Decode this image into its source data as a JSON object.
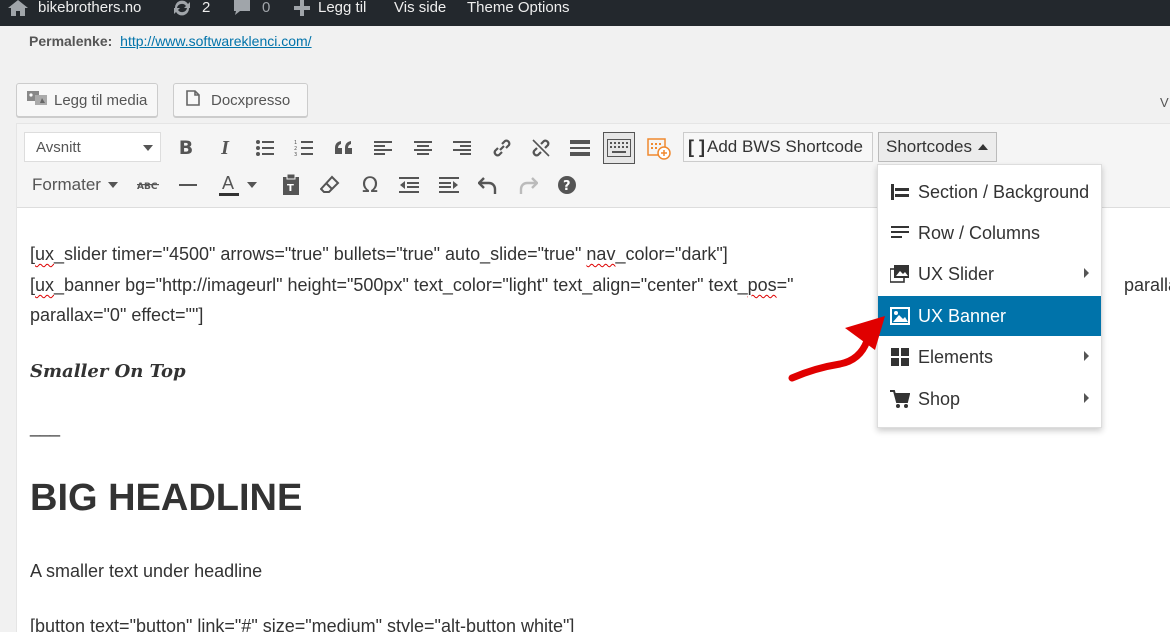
{
  "adminbar": {
    "site_name": "bikebrothers.no",
    "updates_count": "2",
    "comments_count": "0",
    "new_label": "Legg til",
    "view_label": "Vis side",
    "theme_options_label": "Theme Options"
  },
  "permalink": {
    "label": "Permalenke:",
    "url": "http://www.softwareklenci.com/"
  },
  "media_buttons": {
    "add_media": "Legg til media",
    "docxpresso": "Docxpresso"
  },
  "toolbar": {
    "format_select": "Avsnitt",
    "formats_menu": "Formater",
    "add_bws_shortcode": "Add BWS Shortcode",
    "shortcodes": "Shortcodes"
  },
  "editor_tab_fragment": "V",
  "content": {
    "line1_a": "[",
    "line1_b": "ux",
    "line1_c": "_slider timer=\"4500\" arrows=\"true\" bullets=\"true\" auto_slide=\"true\" ",
    "line1_d": "nav",
    "line1_e": "_color=\"dark\"]",
    "line2_a": "[",
    "line2_b": "ux",
    "line2_c": "_banner bg=\"http://imageurl\" height=\"500px\" text_color=\"light\" text_align=\"center\" text_",
    "line2_d": "pos",
    "line2_e": "=\"",
    "line2_right": "parallax",
    "line3": "parallax=\"0\" effect=\"\"]",
    "italic_heading": "Smaller On Top",
    "rule": "___",
    "big_headline": "BIG HEADLINE",
    "subtext": "A smaller text under headline",
    "button_line": "[button text=\"button\" link=\"#\" size=\"medium\" style=\"alt-button white\"]"
  },
  "shortcodes_menu": {
    "items": [
      {
        "label": "Section / Background",
        "submenu": false
      },
      {
        "label": "Row / Columns",
        "submenu": false
      },
      {
        "label": "UX Slider",
        "submenu": true
      },
      {
        "label": "UX Banner",
        "submenu": false,
        "active": true
      },
      {
        "label": "Elements",
        "submenu": true
      },
      {
        "label": "Shop",
        "submenu": true
      }
    ]
  },
  "colors": {
    "adminbar_bg": "#23282d",
    "menu_active": "#0073aa",
    "annotation_arrow": "#e00000"
  }
}
